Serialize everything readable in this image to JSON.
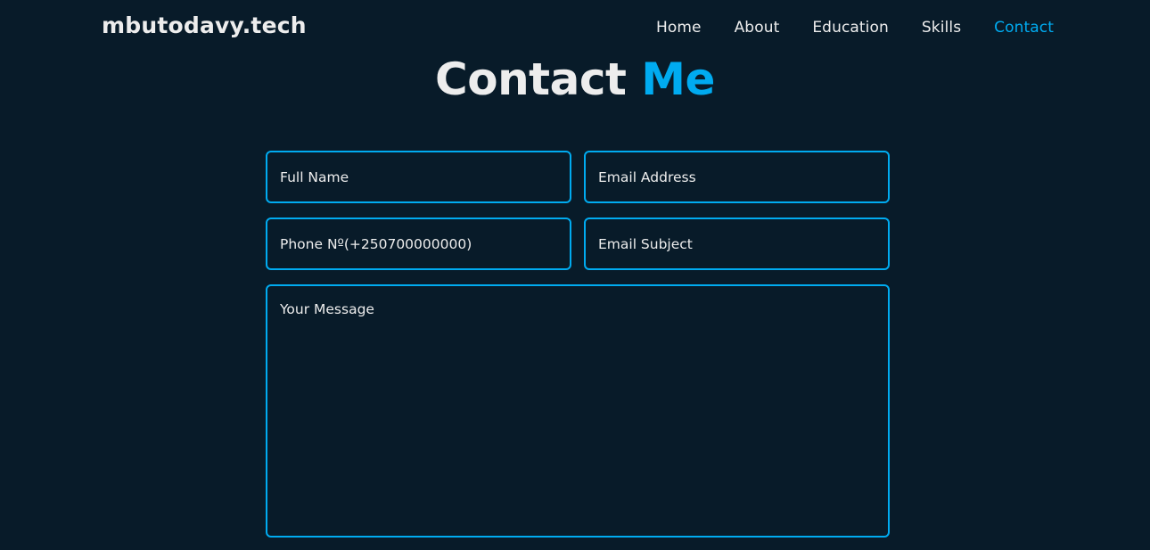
{
  "header": {
    "logo": "mbutodavy.tech",
    "nav": [
      {
        "label": "Home",
        "active": false
      },
      {
        "label": "About",
        "active": false
      },
      {
        "label": "Education",
        "active": false
      },
      {
        "label": "Skills",
        "active": false
      },
      {
        "label": "Contact",
        "active": true
      }
    ]
  },
  "section": {
    "title_main": "Contact",
    "title_accent": "Me"
  },
  "form": {
    "full_name": {
      "placeholder": "Full Name",
      "value": ""
    },
    "email": {
      "placeholder": "Email Address",
      "value": ""
    },
    "phone": {
      "placeholder": "Phone Nº(+250700000000)",
      "value": ""
    },
    "subject": {
      "placeholder": "Email Subject",
      "value": ""
    },
    "message": {
      "placeholder": "Your Message",
      "value": ""
    }
  },
  "colors": {
    "background": "#081b29",
    "accent": "#00abf0",
    "text": "#ededed"
  }
}
